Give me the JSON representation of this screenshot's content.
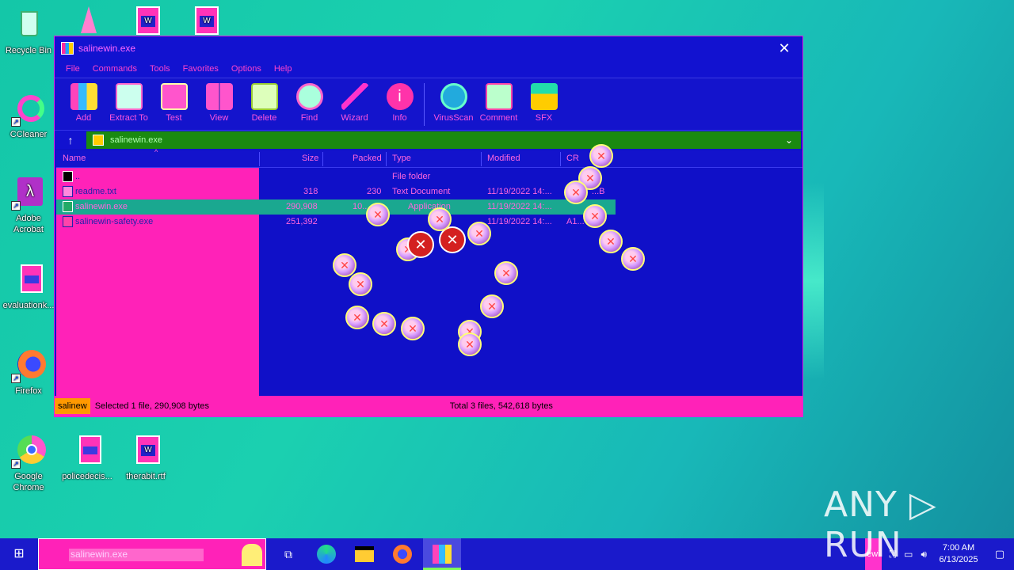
{
  "desktop": {
    "icons": [
      {
        "label": "Recycle Bin"
      },
      {
        "label": "CCleaner"
      },
      {
        "label": "Adobe Acrobat"
      },
      {
        "label": "evaluationk..."
      },
      {
        "label": "Firefox"
      },
      {
        "label": "Google Chrome"
      },
      {
        "label": "policedecis..."
      },
      {
        "label": "therabit.rtf"
      }
    ]
  },
  "window": {
    "title": "salinewin.exe",
    "close_glyph": "✕",
    "menu": [
      "File",
      "Commands",
      "Tools",
      "Favorites",
      "Options",
      "Help"
    ],
    "toolbar": [
      "Add",
      "Extract To",
      "Test",
      "View",
      "Delete",
      "Find",
      "Wizard",
      "Info",
      "VirusScan",
      "Comment",
      "SFX"
    ],
    "address": "salinewin.exe",
    "up_glyph": "↑",
    "columns": {
      "name": "Name",
      "size": "Size",
      "packed": "Packed",
      "type": "Type",
      "modified": "Modified",
      "crc": "CR"
    },
    "rows": [
      {
        "name": "..",
        "size": "",
        "packed": "",
        "type": "File folder",
        "modified": "",
        "crc": ""
      },
      {
        "name": "readme.txt",
        "size": "318",
        "packed": "230",
        "type": "Text Document",
        "modified": "11/19/2022 14:...",
        "crc": "...B"
      },
      {
        "name": "salinewin.exe",
        "size": "290,908",
        "packed": "10...",
        "type": "Application",
        "modified": "11/19/2022 14:...",
        "crc": ""
      },
      {
        "name": "salinewin-safety.exe",
        "size": "251,392",
        "packed": "",
        "type": "",
        "modified": "11/19/2022 14:...",
        "crc": "A1..."
      }
    ],
    "status": {
      "tab": "salinew",
      "left": "Selected 1 file, 290,908 bytes",
      "right": "Total 3 files, 542,618 bytes"
    }
  },
  "taskbar": {
    "search_text": "salinewin.exe",
    "tray_tab": "ewi",
    "time": "7:00 AM",
    "date": "6/13/2025"
  },
  "watermark": "ANY ▷ RUN",
  "colors": {
    "window": "#1010c8",
    "accent_pink": "#ff22b8",
    "address_green": "#1a8a10",
    "selection": "#1aa890"
  }
}
